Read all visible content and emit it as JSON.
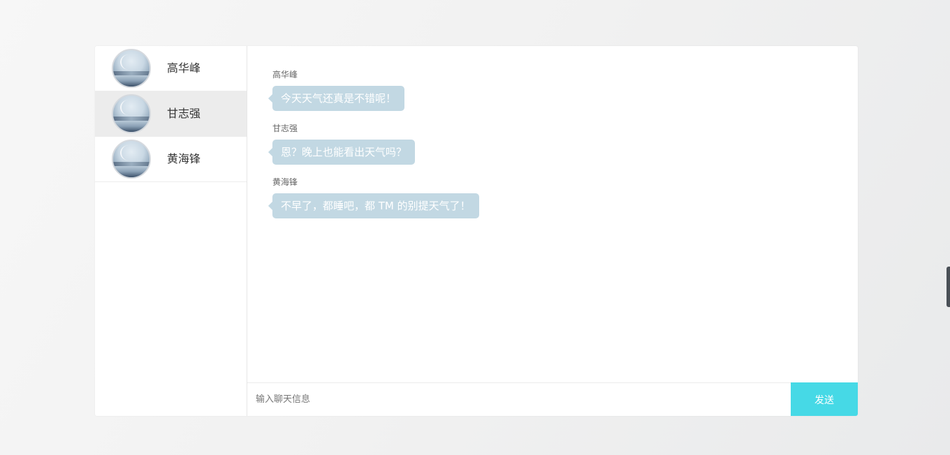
{
  "contacts": [
    {
      "name": "高华峰",
      "active": false
    },
    {
      "name": "甘志强",
      "active": true
    },
    {
      "name": "黄海锋",
      "active": false
    }
  ],
  "messages": [
    {
      "sender": "高华峰",
      "text": "今天天气还真是不错呢！"
    },
    {
      "sender": "甘志强",
      "text": "恩？晚上也能看出天气吗？"
    },
    {
      "sender": "黄海锋",
      "text": "不早了，都睡吧，都 TM 的别提天气了！"
    }
  ],
  "input": {
    "placeholder": "输入聊天信息",
    "value": ""
  },
  "send_label": "发送",
  "colors": {
    "bubble": "#c2d8e3",
    "send_button": "#46d9e6",
    "active_contact": "#ececec"
  }
}
